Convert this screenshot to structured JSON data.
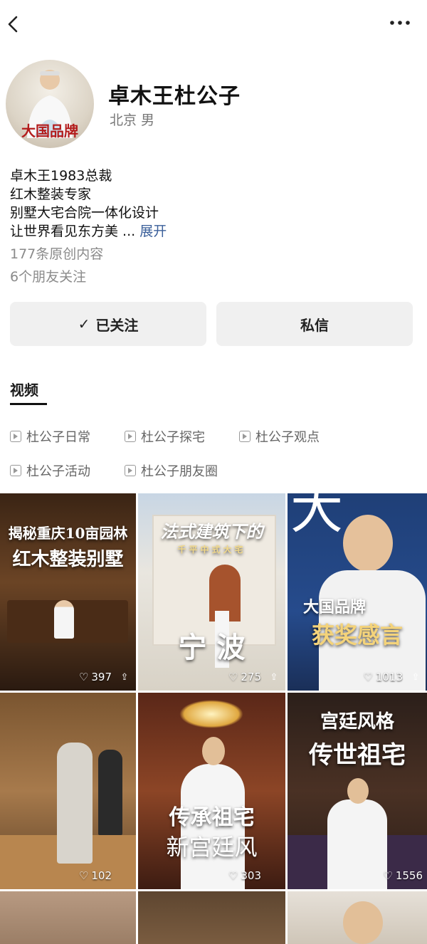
{
  "header": {
    "back_icon": "chevron-left-icon",
    "more_icon": "more-horizontal-icon"
  },
  "profile": {
    "name": "卓木王杜公子",
    "location_gender": "北京 男",
    "avatar_text": "大国品牌",
    "bio_lines": [
      "卓木王1983总裁",
      "红木整装专家",
      "别墅大宅合院一体化设计",
      "让世界看见东方美 ..."
    ],
    "expand_label": "展开",
    "original_count": "177条原创内容",
    "friends_following": "6个朋友关注"
  },
  "actions": {
    "follow_label": "已关注",
    "follow_check": "✓",
    "message_label": "私信"
  },
  "tabs": {
    "active": "视频"
  },
  "collections": [
    "杜公子日常",
    "杜公子探宅",
    "杜公子观点",
    "杜公子活动",
    "杜公子朋友圈"
  ],
  "videos": [
    {
      "cap1": "揭秘重庆10亩园林",
      "cap2": "红木整装别墅",
      "likes": "397"
    },
    {
      "cap1": "法式建筑下的",
      "cap2": "宁 波",
      "sub": "千平中式大宅",
      "likes": "275"
    },
    {
      "cap1": "大国品牌",
      "cap2": "获奖感言",
      "bg_text": "大",
      "likes": "1013"
    },
    {
      "likes": "102"
    },
    {
      "cap1": "传承祖宅",
      "cap2": "新宫廷风",
      "likes": "303"
    },
    {
      "cap1": "宫廷风格",
      "cap2": "传世祖宅",
      "likes": "1556"
    }
  ],
  "colors": {
    "accent_link": "#3a5f9a",
    "button_bg": "#f0f0f0"
  }
}
